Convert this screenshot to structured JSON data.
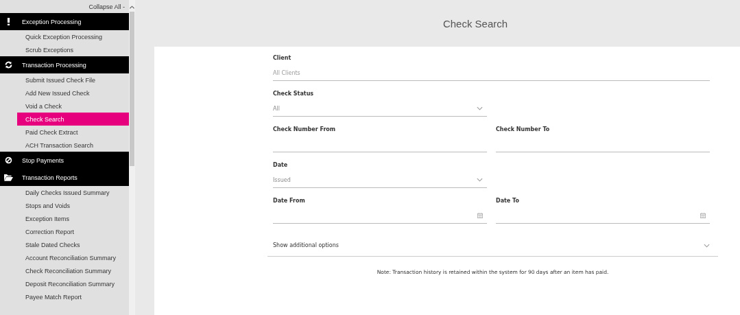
{
  "sidebar": {
    "collapse_label": "Collapse All -",
    "groups": [
      {
        "label": "Exception Processing",
        "kind": "exclamation",
        "items": [
          {
            "label": "Quick Exception Processing",
            "selected": false
          },
          {
            "label": "Scrub Exceptions",
            "selected": false
          }
        ]
      },
      {
        "label": "Transaction Processing",
        "kind": "refresh",
        "items": [
          {
            "label": "Submit Issued Check File",
            "selected": false
          },
          {
            "label": "Add New Issued Check",
            "selected": false
          },
          {
            "label": "Void a Check",
            "selected": false
          },
          {
            "label": "Check Search",
            "selected": true
          },
          {
            "label": "Paid Check Extract",
            "selected": false
          },
          {
            "label": "ACH Transaction Search",
            "selected": false
          }
        ]
      },
      {
        "label": "Stop Payments",
        "kind": "block"
      },
      {
        "label": "Transaction Reports",
        "kind": "folder",
        "items": [
          {
            "label": "Daily Checks Issued Summary",
            "selected": false
          },
          {
            "label": "Stops and Voids",
            "selected": false
          },
          {
            "label": "Exception Items",
            "selected": false
          },
          {
            "label": "Correction Report",
            "selected": false
          },
          {
            "label": "Stale Dated Checks",
            "selected": false
          },
          {
            "label": "Account Reconciliation Summary",
            "selected": false
          },
          {
            "label": "Check Reconciliation Summary",
            "selected": false
          },
          {
            "label": "Deposit Reconciliation Summary",
            "selected": false
          },
          {
            "label": "Payee Match Report",
            "selected": false
          }
        ]
      }
    ]
  },
  "page": {
    "title": "Check Search"
  },
  "form": {
    "rows": [
      [
        {
          "label": "Client",
          "kind": "text",
          "placeholder": "All Clients"
        }
      ],
      [
        {
          "label": "Check Status",
          "kind": "select",
          "value": "All"
        }
      ],
      [
        {
          "label": "Check Number From",
          "kind": "text"
        },
        {
          "label": "Check Number To",
          "kind": "text"
        }
      ],
      [
        {
          "label": "Date",
          "kind": "select",
          "value": "Issued"
        }
      ],
      [
        {
          "label": "Date From",
          "kind": "date"
        },
        {
          "label": "Date To",
          "kind": "date"
        }
      ]
    ],
    "more_options": {
      "label": "Show additional options",
      "expanded": false
    },
    "note": "Note: Transaction history is retained within the system for 90 days after an item has paid."
  }
}
